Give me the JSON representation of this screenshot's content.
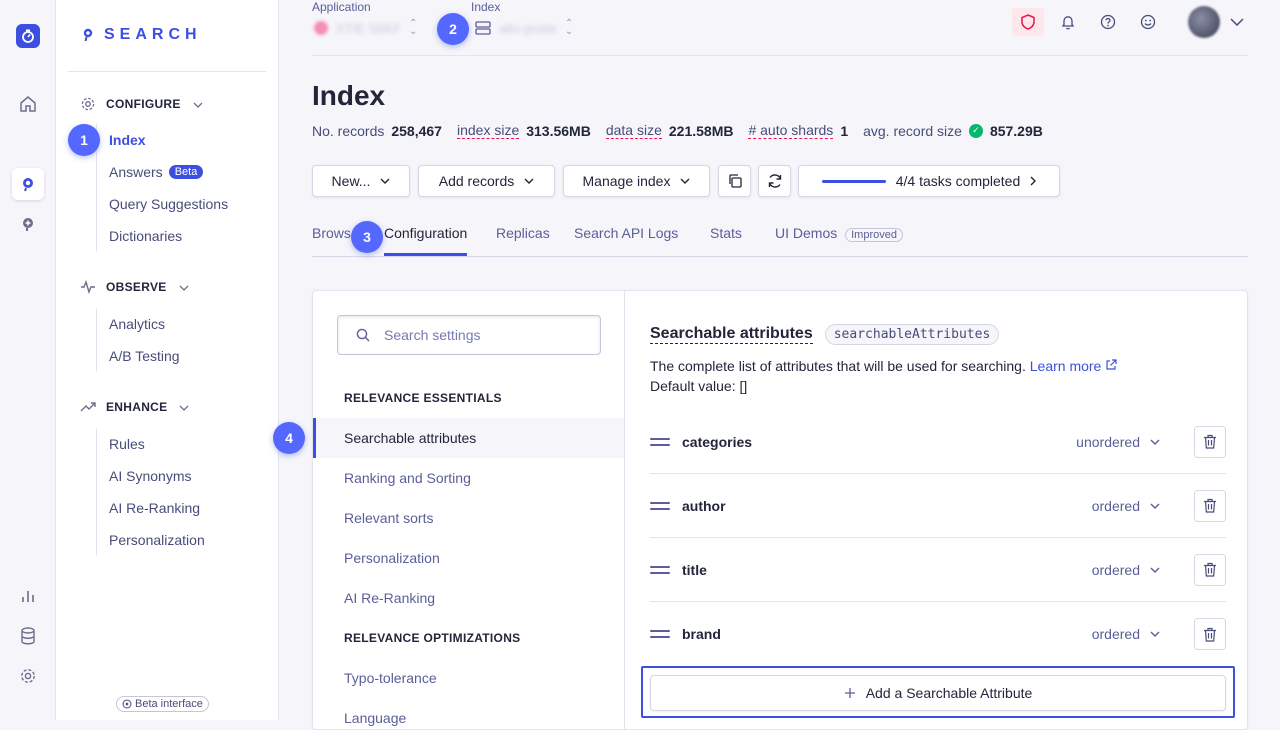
{
  "app": {
    "brand": "SEARCH"
  },
  "header": {
    "application_label": "Application",
    "application_value": "XTIE S6KF",
    "index_label": "Index",
    "index_value": "alto-prodx"
  },
  "sidebar": {
    "sections": [
      {
        "title": "CONFIGURE",
        "items": [
          "Index",
          "Answers",
          "Query Suggestions",
          "Dictionaries"
        ]
      },
      {
        "title": "OBSERVE",
        "items": [
          "Analytics",
          "A/B Testing"
        ]
      },
      {
        "title": "ENHANCE",
        "items": [
          "Rules",
          "AI Synonyms",
          "AI Re-Ranking",
          "Personalization"
        ]
      }
    ],
    "answers_badge": "Beta",
    "beta_interface": "Beta interface"
  },
  "badges": [
    "1",
    "2",
    "3",
    "4"
  ],
  "page": {
    "title": "Index",
    "stats": {
      "records_label": "No. records",
      "records_value": "258,467",
      "index_size_label": "index size",
      "index_size_value": "313.56MB",
      "data_size_label": "data size",
      "data_size_value": "221.58MB",
      "shards_label": "# auto shards",
      "shards_value": "1",
      "avg_label": "avg. record size",
      "avg_value": "857.29B"
    },
    "toolbar": {
      "new_label": "New...",
      "add_records_label": "Add records",
      "manage_index_label": "Manage index",
      "tasks_label": "4/4 tasks completed",
      "tasks_progress": 1.0
    },
    "tabs": [
      "Browse",
      "Configuration",
      "Replicas",
      "Search API Logs",
      "Stats",
      "UI Demos"
    ],
    "tab_badge": "Improved"
  },
  "settings": {
    "search_placeholder": "Search settings",
    "category_1": "RELEVANCE ESSENTIALS",
    "category_1_items": [
      "Searchable attributes",
      "Ranking and Sorting",
      "Relevant sorts",
      "Personalization",
      "AI Re-Ranking"
    ],
    "category_2": "RELEVANCE OPTIMIZATIONS",
    "category_2_items": [
      "Typo-tolerance",
      "Language"
    ]
  },
  "detail": {
    "title": "Searchable attributes",
    "code": "searchableAttributes",
    "description": "The complete list of attributes that will be used for searching.",
    "learn_more": "Learn more",
    "default_value": "Default value: []",
    "attributes": [
      {
        "name": "categories",
        "mode": "unordered"
      },
      {
        "name": "author",
        "mode": "ordered"
      },
      {
        "name": "title",
        "mode": "ordered"
      },
      {
        "name": "brand",
        "mode": "ordered"
      }
    ],
    "add_label": "Add a Searchable Attribute"
  },
  "colors": {
    "accent": "#3c4fe0",
    "badge": "#5468ff",
    "success": "#06b66c",
    "alert": "#e8174f"
  }
}
